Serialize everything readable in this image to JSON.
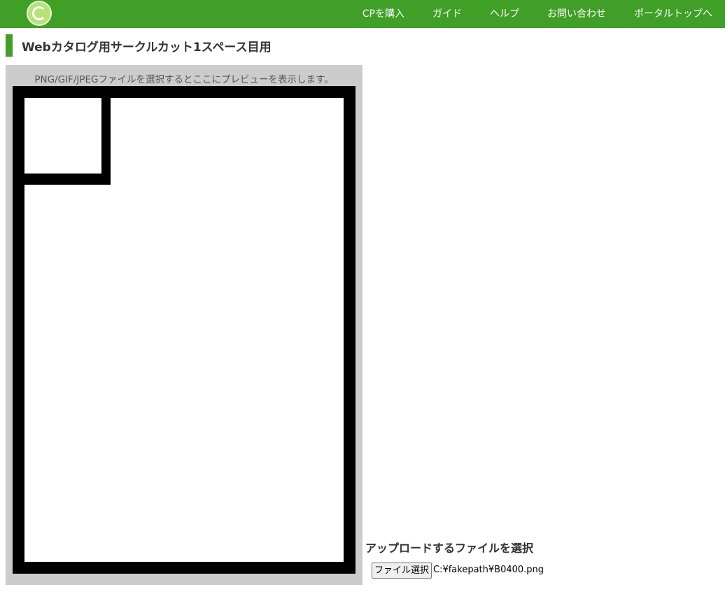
{
  "header": {
    "logo_icon": "circle-ms-logo-icon",
    "nav": [
      {
        "label": "CPを購入"
      },
      {
        "label": "ガイド"
      },
      {
        "label": "ヘルプ"
      },
      {
        "label": "お問い合わせ"
      },
      {
        "label": "ポータルトップへ"
      }
    ]
  },
  "page": {
    "title": "Webカタログ用サークルカット1スペース目用"
  },
  "preview": {
    "hint": "PNG/GIF/JPEGファイルを選択するとここにプレビューを表示します。"
  },
  "upload": {
    "heading": "アップロードするファイルを選択",
    "button_label": "ファイル選択",
    "file_name": "C:¥fakepath¥B0400.png"
  },
  "colors": {
    "brand_green": "#3f9f27",
    "panel_gray": "#cccccc"
  }
}
